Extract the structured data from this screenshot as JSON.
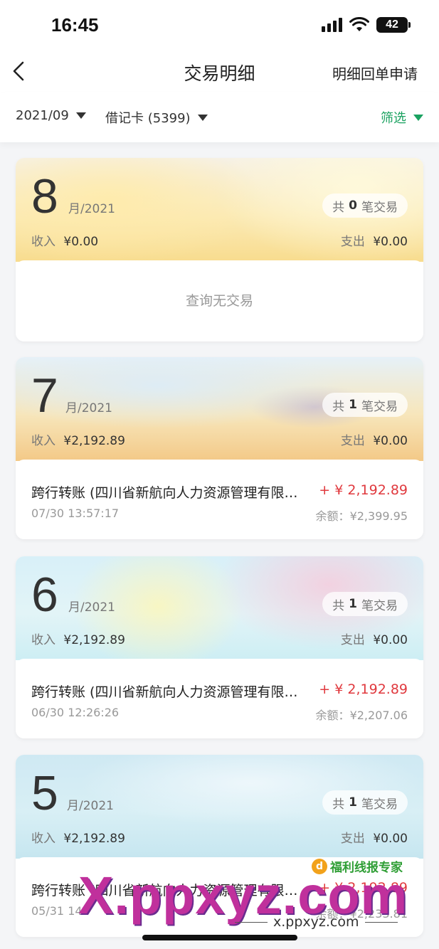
{
  "status_bar": {
    "time": "16:45",
    "battery": "42"
  },
  "nav": {
    "title": "交易明细",
    "action_label": "明细回单申请"
  },
  "filters": {
    "date": "2021/09",
    "card": "借记卡 (5399)",
    "screen": "筛选"
  },
  "labels": {
    "count_prefix": "共",
    "count_suffix": "笔交易",
    "income": "收入",
    "expense": "支出",
    "empty": "查询无交易",
    "balance_prefix": "余额："
  },
  "months": [
    {
      "month": "8",
      "year": "月/2021",
      "count": "0",
      "income": "¥0.00",
      "expense": "¥0.00",
      "transactions": []
    },
    {
      "month": "7",
      "year": "月/2021",
      "count": "1",
      "income": "¥2,192.89",
      "expense": "¥0.00",
      "transactions": [
        {
          "title": "跨行转账 (四川省新航向人力资源管理有限公司)",
          "amount": "+ ¥ 2,192.89",
          "time": "07/30  13:57:17",
          "balance": "¥2,399.95"
        }
      ]
    },
    {
      "month": "6",
      "year": "月/2021",
      "count": "1",
      "income": "¥2,192.89",
      "expense": "¥0.00",
      "transactions": [
        {
          "title": "跨行转账 (四川省新航向人力资源管理有限公司)",
          "amount": "+ ¥ 2,192.89",
          "time": "06/30  12:26:26",
          "balance": "¥2,207.06"
        }
      ]
    },
    {
      "month": "5",
      "year": "月/2021",
      "count": "1",
      "income": "¥2,192.89",
      "expense": "¥0.00",
      "transactions": [
        {
          "title": "跨行转账 (四川省新航向人力资源管理有限公司)",
          "amount": "+ ¥ 2,192.89",
          "time": "05/31  14:",
          "balance": "¥2,233.81"
        }
      ]
    }
  ],
  "watermark": {
    "badge": "福利线报专家",
    "main": "X.ppxyz.com",
    "url": "x.ppxyz.com"
  },
  "colors": {
    "accent_green": "#1aa260",
    "amount_red": "#e0393e"
  },
  "icons": [
    "back-chevron-icon",
    "signal-icon",
    "wifi-icon",
    "battery-icon",
    "dropdown-triangle-icon"
  ]
}
